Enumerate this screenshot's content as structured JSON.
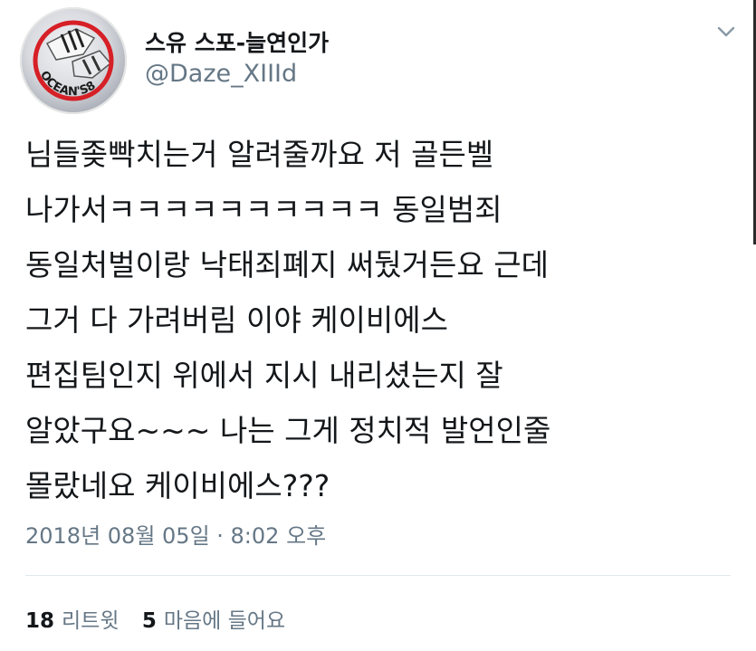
{
  "user": {
    "display_name": "스유 스포-늘연인가",
    "handle": "@Daze_XIIId",
    "avatar_text": "OCEAN'S8"
  },
  "menu_icon": "chevron-down-icon",
  "tweet": {
    "lines": [
      "님들좆빡치는거 알려줄까요 저 골든벨",
      "나가서ㅋㅋㅋㅋㅋㅋㅋㅋㅋㅋ 동일범죄",
      "동일처벌이랑 낙태죄폐지 써뒀거든요 근데",
      "그거 다 가려버림 이야 케이비에스",
      "편집팀인지 위에서 지시 내리셨는지 잘",
      "알았구요~~~ 나는 그게 정치적 발언인줄",
      "몰랐네요 케이비에스???"
    ],
    "timestamp": "2018년 08월 05일 · 8:02 오후"
  },
  "stats": {
    "retweet_count": "18",
    "retweet_label": "리트윗",
    "like_count": "5",
    "like_label": "마음에 들어요"
  },
  "colors": {
    "text": "#14171a",
    "secondary": "#657786",
    "divider": "#e1e8ed",
    "avatar_ring": "#d61f26"
  }
}
